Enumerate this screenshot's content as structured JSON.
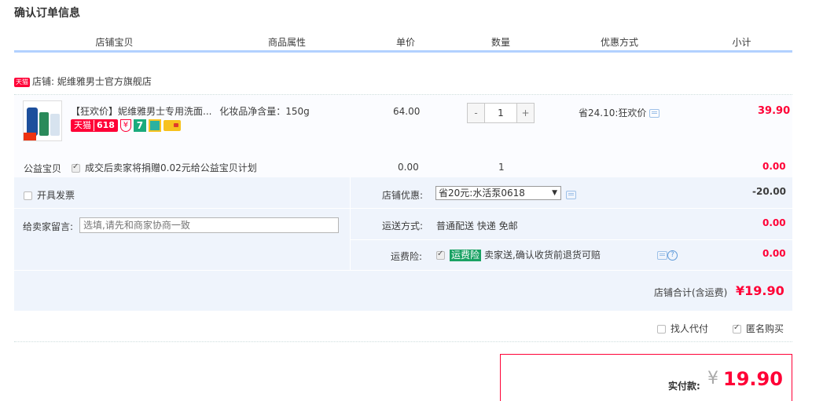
{
  "page": {
    "title": "确认订单信息"
  },
  "table_header": [
    "店铺宝贝",
    "商品属性",
    "单价",
    "数量",
    "优惠方式",
    "小计"
  ],
  "shop": {
    "badge": "天猫",
    "label": "店铺: 妮维雅男士官方旗舰店"
  },
  "item": {
    "title": "【狂欢价】妮维雅男士专用洗面...",
    "attribute": "化妆品净含量：150g",
    "badges": {
      "tmall": "天猫",
      "event": "618",
      "shield": "¥",
      "seven": "7"
    },
    "price": "64.00",
    "quantity": "1",
    "minus": "-",
    "plus": "+",
    "discount": "省24.10:狂欢价",
    "subtotal": "39.90"
  },
  "charity": {
    "label": "公益宝贝",
    "text": "成交后卖家将捐赠0.02元给公益宝贝计划",
    "price": "0.00",
    "quantity": "1",
    "subtotal": "0.00"
  },
  "invoice": {
    "label": "开具发票"
  },
  "shop_discount": {
    "label": "店铺优惠:",
    "selected": "省20元:水活泵0618",
    "amount": "-20.00"
  },
  "message": {
    "label": "给卖家留言:",
    "placeholder": "选填,请先和商家协商一致"
  },
  "shipping": {
    "label": "运送方式:",
    "value": "普通配送 快递 免邮",
    "amount": "0.00"
  },
  "insurance": {
    "label": "运费险:",
    "tag": "运费险",
    "text": "卖家送,确认收货前退货可赔",
    "help": "?",
    "amount": "0.00"
  },
  "shop_total": {
    "label": "店铺合计(含运费)",
    "value": "¥19.90"
  },
  "options": {
    "proxy_pay": "找人代付",
    "anonymous": "匿名购买"
  },
  "payment": {
    "label": "实付款:",
    "currency": "¥",
    "value": "19.90"
  },
  "colors": {
    "accent_red": "#ff0036",
    "header_line": "#b2d1ff",
    "panel_bg": "#eff4fc",
    "insurance_green": "#1aa264"
  }
}
